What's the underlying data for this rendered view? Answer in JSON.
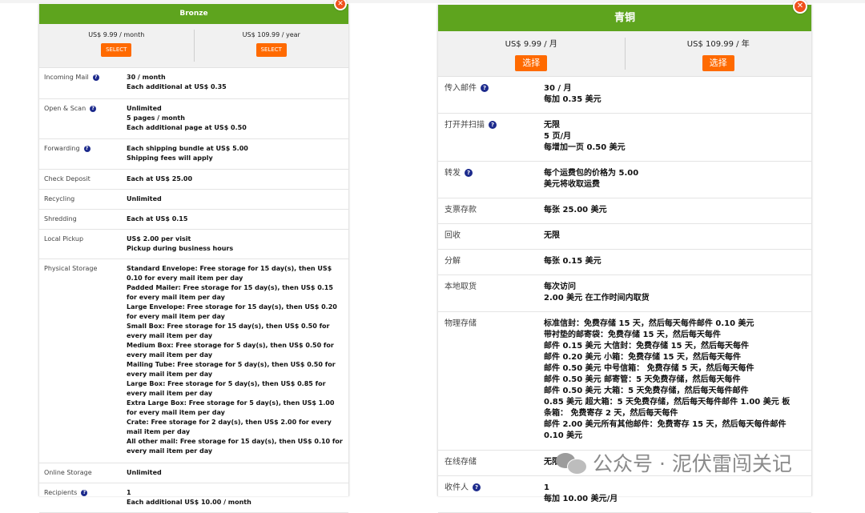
{
  "left": {
    "title": "Bronze",
    "plans": [
      {
        "price": "US$ 9.99 / month",
        "button": "SELECT"
      },
      {
        "price": "US$ 109.99 / year",
        "button": "SELECT"
      }
    ],
    "rows": [
      {
        "label": "Incoming Mail",
        "help": true,
        "lines": [
          "30 / month",
          "Each additional at US$ 0.35"
        ]
      },
      {
        "label": "Open & Scan",
        "help": true,
        "lines": [
          "Unlimited",
          "5 pages / month",
          "Each additional page at US$ 0.50"
        ]
      },
      {
        "label": "Forwarding",
        "help": true,
        "lines": [
          "Each shipping bundle at US$ 5.00",
          "Shipping fees will apply"
        ]
      },
      {
        "label": "Check Deposit",
        "help": false,
        "lines": [
          "Each at US$ 25.00"
        ]
      },
      {
        "label": "Recycling",
        "help": false,
        "lines": [
          "Unlimited"
        ]
      },
      {
        "label": "Shredding",
        "help": false,
        "lines": [
          "Each at US$ 0.15"
        ]
      },
      {
        "label": "Local Pickup",
        "help": false,
        "lines": [
          "US$ 2.00 per visit",
          "Pickup during business hours"
        ]
      },
      {
        "label": "Physical Storage",
        "help": false,
        "lines": [
          "Standard Envelope: Free storage for 15 day(s), then US$ 0.10 for every mail item per day",
          "Padded Mailer: Free storage for 15 day(s), then US$ 0.15 for every mail item per day",
          "Large Envelope: Free storage for 15 day(s), then US$ 0.20 for every mail item per day",
          "Small Box: Free storage for 15 day(s), then US$ 0.50 for every mail item per day",
          "Medium Box: Free storage for 5 day(s), then US$ 0.50 for every mail item per day",
          "Mailing Tube: Free storage for 5 day(s), then US$ 0.50 for every mail item per day",
          "Large Box: Free storage for 5 day(s), then US$ 0.85 for every mail item per day",
          "Extra Large Box: Free storage for 5 day(s), then US$ 1.00 for every mail item per day",
          "Crate: Free storage for 2 day(s), then US$ 2.00 for every mail item per day",
          "All other mail: Free storage for 15 day(s), then US$ 0.10 for every mail item per day"
        ]
      },
      {
        "label": "Online Storage",
        "help": false,
        "lines": [
          "Unlimited"
        ]
      },
      {
        "label": "Recipients",
        "help": true,
        "lines": [
          "1",
          "Each additional US$ 10.00 / month"
        ]
      }
    ]
  },
  "right": {
    "title": "青铜",
    "plans": [
      {
        "price": "US$ 9.99 / 月",
        "button": "选择"
      },
      {
        "price": "US$ 109.99 / 年",
        "button": "选择"
      }
    ],
    "rows": [
      {
        "label": "传入邮件",
        "help": true,
        "lines": [
          "30 / 月",
          "每加 0.35 美元"
        ]
      },
      {
        "label": "打开并扫描",
        "help": true,
        "lines": [
          "无限",
          "5 页/月",
          "每增加一页 0.50 美元"
        ]
      },
      {
        "label": "转发",
        "help": true,
        "lines": [
          "每个运费包的价格为 5.00",
          "美元将收取运费"
        ]
      },
      {
        "label": "支票存款",
        "help": false,
        "lines": [
          "每张 25.00 美元"
        ]
      },
      {
        "label": "回收",
        "help": false,
        "lines": [
          "无限"
        ]
      },
      {
        "label": "分解",
        "help": false,
        "lines": [
          "每张 0.15 美元"
        ]
      },
      {
        "label": "本地取货",
        "help": false,
        "lines": [
          "每次访问",
          "2.00 美元 在工作时间内取货"
        ]
      },
      {
        "label": "物理存储",
        "help": false,
        "lines": [
          "标准信封：免费存储 15 天，然后每天每件邮件 0.10 美元",
          "带衬垫的邮寄袋：免费存储 15 天，然后每天每件",
          "邮件 0.15 美元 大信封：免费存储 15 天，然后每天每件",
          "邮件 0.20 美元 小箱：免费存储 15 天，然后每天每件",
          "邮件 0.50 美元 中号信箱： 免费存储 5 天，然后每天每件",
          "邮件 0.50 美元 邮寄管：5 天免费存储，然后每天每件",
          "邮件 0.50 美元 大箱：5 天免费存储，然后每天每件邮件",
          "0.85 美元 超大箱：5 天免费存储，然后每天每件邮件 1.00 美元 板",
          "条箱： 免费寄存 2 天，然后每天每件",
          "邮件 2.00 美元所有其他邮件：免费寄存 15 天，然后每天每件邮件 0.10 美元"
        ]
      },
      {
        "label": "在线存储",
        "help": false,
        "lines": [
          "无限"
        ]
      },
      {
        "label": "收件人",
        "help": true,
        "lines": [
          "1",
          "每加 10.00 美元/月"
        ]
      }
    ]
  },
  "watermark": {
    "text": "公众号 · 泥伏雷闯关记",
    "icon": "wechat-icon"
  },
  "colors": {
    "header": "#5ea41e",
    "button": "#ff6a00",
    "close": "#f0511d",
    "help": "#1c2a8c"
  }
}
